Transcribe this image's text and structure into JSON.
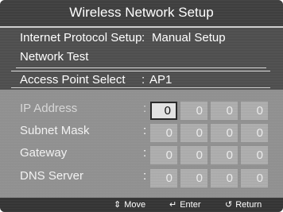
{
  "title": "Wireless Network Setup",
  "rows": {
    "ip_setup": {
      "label": "Internet Protocol Setup",
      "value": "Manual Setup"
    },
    "network_test": {
      "label": "Network Test"
    },
    "ap_select": {
      "label": "Access Point Select",
      "value": "AP1"
    }
  },
  "separator": ":",
  "ip_fields": [
    {
      "label": "IP Address",
      "octets": [
        "0",
        "0",
        "0",
        "0"
      ]
    },
    {
      "label": "Subnet Mask",
      "octets": [
        "0",
        "0",
        "0",
        "0"
      ]
    },
    {
      "label": "Gateway",
      "octets": [
        "0",
        "0",
        "0",
        "0"
      ]
    },
    {
      "label": "DNS Server",
      "octets": [
        "0",
        "0",
        "0",
        "0"
      ]
    }
  ],
  "footer": {
    "move": {
      "icon": "updown-arrows-icon",
      "glyph": "⇕",
      "label": "Move"
    },
    "enter": {
      "icon": "enter-icon",
      "glyph": "↵",
      "label": "Enter"
    },
    "return": {
      "icon": "return-icon",
      "glyph": "↺",
      "label": "Return"
    }
  },
  "colors": {
    "active_octet": "#e2e2e2",
    "inactive_octet": "#a8a8a8",
    "panel": "#4a4a4a"
  }
}
